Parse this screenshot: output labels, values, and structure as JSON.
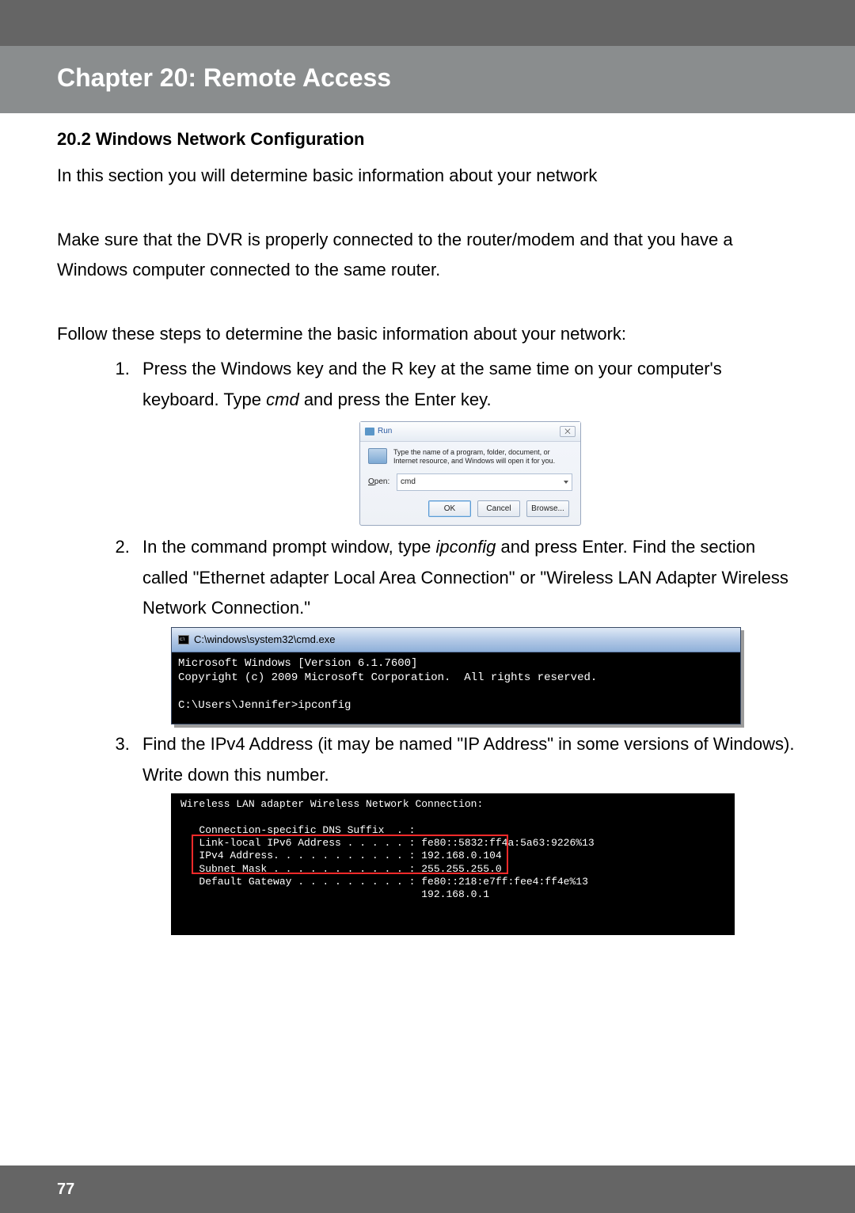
{
  "header": {
    "chapter_title": "Chapter 20: Remote Access"
  },
  "section": {
    "heading": "20.2 Windows Network Configuration",
    "intro": "In this section you will determine basic information about your network",
    "para_connect": "Make sure that the DVR is properly connected to the router/modem and that you have a Windows computer connected to the same router.",
    "para_follow": "Follow these steps to determine the basic information about your network:"
  },
  "steps": {
    "s1a": "Press the Windows key and the R key at the same time on your computer's keyboard. Type ",
    "s1_cmd": "cmd",
    "s1b": " and press the Enter key.",
    "s2a": "In the command prompt window, type ",
    "s2_cmd": "ipconfig",
    "s2b": " and press Enter. Find the section called \"Ethernet adapter Local Area Connection\" or \"Wireless LAN Adapter Wireless Network Connection.\"",
    "s3": "Find the IPv4 Address (it may be named \"IP Address\" in some versions of Windows). Write down this number."
  },
  "run_dialog": {
    "title": "Run",
    "close_glyph": "⨉",
    "description": "Type the name of a program, folder, document, or Internet resource, and Windows will open it for you.",
    "open_label": "Open:",
    "open_value": "cmd",
    "ok": "OK",
    "cancel": "Cancel",
    "browse": "Browse..."
  },
  "cmd1": {
    "title": "C:\\windows\\system32\\cmd.exe",
    "line1": "Microsoft Windows [Version 6.1.7600]",
    "line2": "Copyright (c) 2009 Microsoft Corporation.  All rights reserved.",
    "blank": "",
    "line3": "C:\\Users\\Jennifer>ipconfig"
  },
  "cmd2": {
    "header": "Wireless LAN adapter Wireless Network Connection:",
    "blank": "",
    "dns": "   Connection-specific DNS Suffix  . :",
    "ll": "   Link-local IPv6 Address . . . . . : fe80::5832:ff4a:5a63:9226%13",
    "ipv4": "   IPv4 Address. . . . . . . . . . . : 192.168.0.104",
    "mask": "   Subnet Mask . . . . . . . . . . . : 255.255.255.0",
    "gw1": "   Default Gateway . . . . . . . . . : fe80::218:e7ff:fee4:ff4e%13",
    "gw2": "                                       192.168.0.1"
  },
  "footer": {
    "page": "77"
  }
}
